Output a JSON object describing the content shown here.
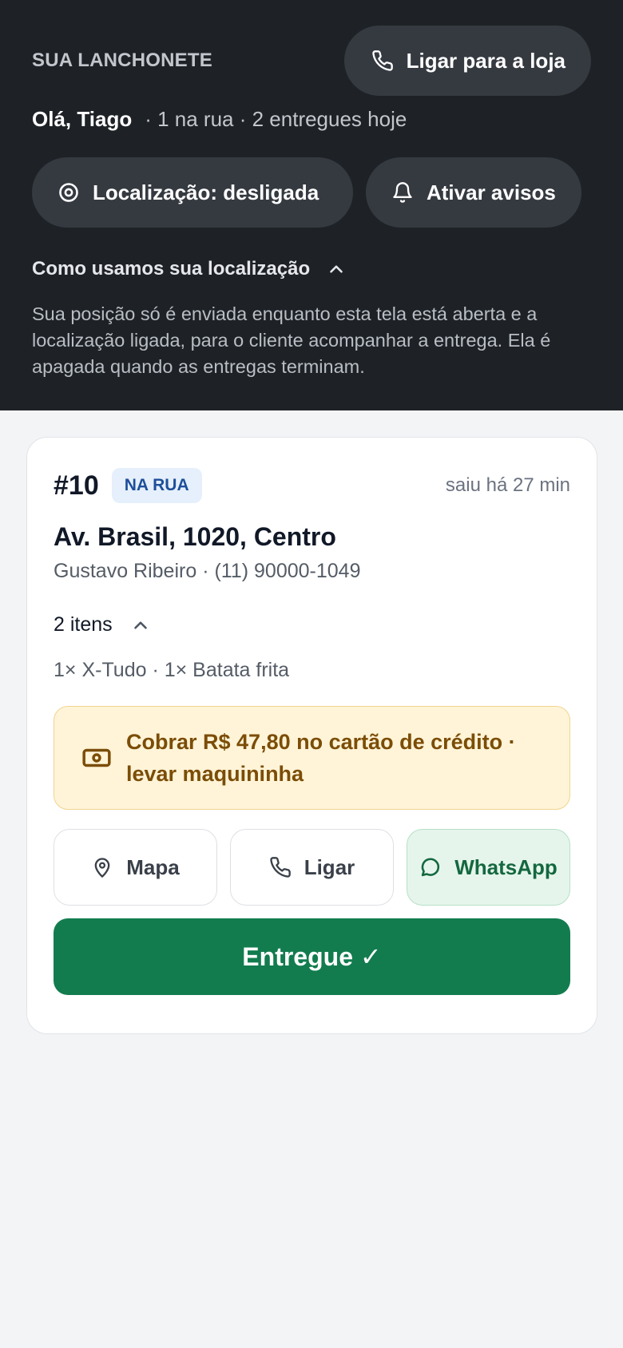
{
  "header": {
    "brand": "SUA LANCHONETE",
    "store_call_label": "Ligar para a loja",
    "greeting": "Olá, Tiago",
    "stats": "· 1 na rua · 2 entregues hoje",
    "location_label": "Localização: desligada",
    "notifications_label": "Ativar avisos",
    "howto_label": "Como usamos sua localização",
    "explanation": "Sua posição só é enviada enquanto esta tela está aberta e a localização ligada, para o cliente acompanhar a entrega. Ela é apagada quando as entregas terminam."
  },
  "order": {
    "number": "#10",
    "status_badge": "NA RUA",
    "time": "saiu há 27 min",
    "address": "Av. Brasil, 1020, Centro",
    "customer": "Gustavo Ribeiro · (11) 90000-1049",
    "items_toggle": "2 itens",
    "items_list": "1× X-Tudo · 1× Batata frita",
    "payment_note": "Cobrar R$ 47,80 no cartão de crédito · levar maquininha",
    "actions": {
      "map": "Mapa",
      "call": "Ligar",
      "whatsapp": "WhatsApp"
    },
    "deliver_label": "Entregue ✓"
  },
  "colors": {
    "header_bg": "#1e2227",
    "success": "#127c4e",
    "warning_bg": "#fff4d8",
    "badge_bg": "#e6effc"
  },
  "icons": [
    "phone-icon",
    "target-icon",
    "bell-icon",
    "chevron-up-icon",
    "cash-icon",
    "map-pin-icon",
    "whatsapp-icon"
  ]
}
